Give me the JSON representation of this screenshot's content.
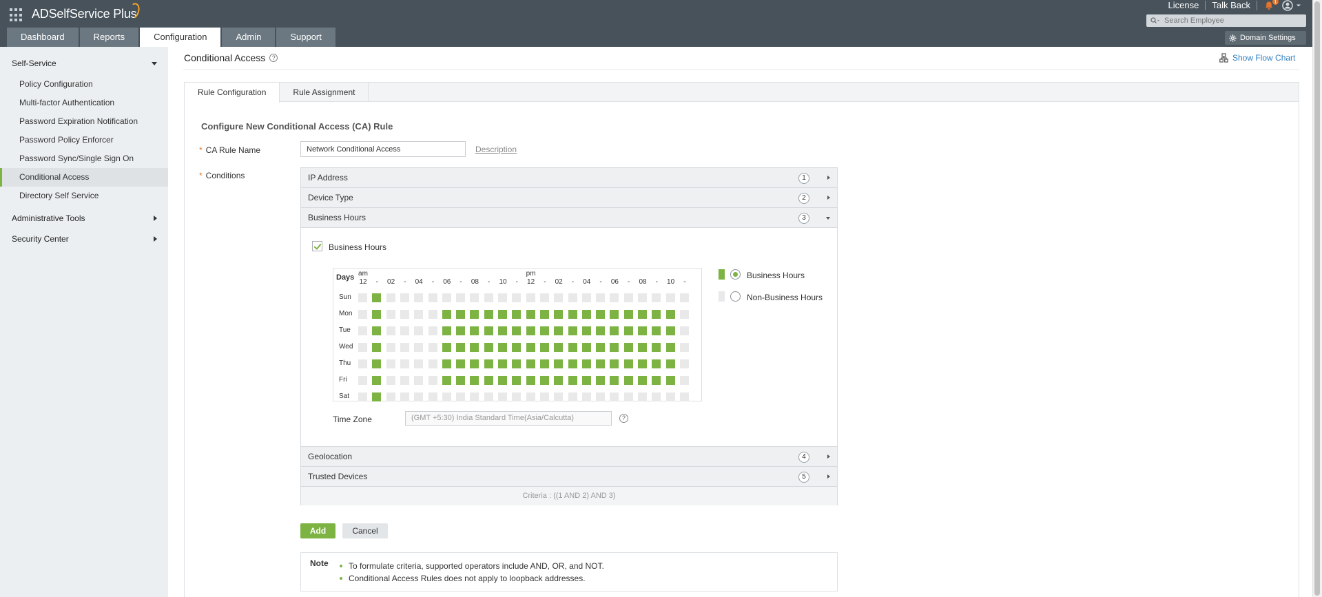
{
  "header": {
    "app_title": "ADSelfService Plus",
    "tabs": [
      {
        "label": "Dashboard",
        "active": false
      },
      {
        "label": "Reports",
        "active": false
      },
      {
        "label": "Configuration",
        "active": true
      },
      {
        "label": "Admin",
        "active": false
      },
      {
        "label": "Support",
        "active": false
      }
    ],
    "links": [
      "License",
      "Talk Back"
    ],
    "notification_count": "1",
    "search_placeholder": "Search Employee",
    "domain_settings_label": "Domain Settings"
  },
  "sidebar": {
    "sections": [
      {
        "title": "Self-Service",
        "expanded": true,
        "items": [
          {
            "label": "Policy Configuration",
            "active": false
          },
          {
            "label": "Multi-factor Authentication",
            "active": false
          },
          {
            "label": "Password Expiration Notification",
            "active": false
          },
          {
            "label": "Password Policy Enforcer",
            "active": false
          },
          {
            "label": "Password Sync/Single Sign On",
            "active": false
          },
          {
            "label": "Conditional Access",
            "active": true
          },
          {
            "label": "Directory Self Service",
            "active": false
          }
        ]
      },
      {
        "title": "Administrative Tools",
        "expanded": false,
        "items": []
      },
      {
        "title": "Security Center",
        "expanded": false,
        "items": []
      }
    ]
  },
  "page": {
    "title": "Conditional Access",
    "flow_chart_label": "Show Flow Chart",
    "tabs": [
      {
        "label": "Rule Configuration",
        "active": true
      },
      {
        "label": "Rule Assignment",
        "active": false
      }
    ],
    "section_title": "Configure New Conditional Access (CA) Rule",
    "rule_name_label": "CA Rule Name",
    "rule_name_value": "Network Conditional Access",
    "description_link": "Description",
    "conditions_label": "Conditions",
    "required_marker": "*",
    "conditions_top": [
      {
        "label": "IP Address",
        "num": "1",
        "expanded": false
      },
      {
        "label": "Device Type",
        "num": "2",
        "expanded": false
      },
      {
        "label": "Business Hours",
        "num": "3",
        "expanded": true
      }
    ],
    "conditions_bottom": [
      {
        "label": "Geolocation",
        "num": "4",
        "expanded": false
      },
      {
        "label": "Trusted Devices",
        "num": "5",
        "expanded": false
      }
    ],
    "criteria_label": "Criteria :",
    "criteria_value": "((1 AND 2) AND 3)",
    "add_label": "Add",
    "cancel_label": "Cancel",
    "note_label": "Note",
    "notes": [
      "To formulate criteria, supported operators include AND, OR, and NOT.",
      "Conditional Access Rules does not apply to loopback addresses."
    ]
  },
  "business_hours": {
    "enabled": true,
    "checkbox_label": "Business Hours",
    "days_header": "Days",
    "am_label": "am",
    "pm_label": "pm",
    "hour_labels": [
      "12",
      "-",
      "02",
      "-",
      "04",
      "-",
      "06",
      "-",
      "08",
      "-",
      "10",
      "-",
      "12",
      "-",
      "02",
      "-",
      "04",
      "-",
      "06",
      "-",
      "08",
      "-",
      "10",
      "-"
    ],
    "days": [
      "Sun",
      "Mon",
      "Tue",
      "Wed",
      "Thu",
      "Fri",
      "Sat"
    ],
    "grid": [
      [
        0,
        1,
        0,
        0,
        0,
        0,
        0,
        0,
        0,
        0,
        0,
        0,
        0,
        0,
        0,
        0,
        0,
        0,
        0,
        0,
        0,
        0,
        0,
        0
      ],
      [
        0,
        1,
        0,
        0,
        0,
        0,
        1,
        1,
        1,
        1,
        1,
        1,
        1,
        1,
        1,
        1,
        1,
        1,
        1,
        1,
        1,
        1,
        1,
        0
      ],
      [
        0,
        1,
        0,
        0,
        0,
        0,
        1,
        1,
        1,
        1,
        1,
        1,
        1,
        1,
        1,
        1,
        1,
        1,
        1,
        1,
        1,
        1,
        1,
        0
      ],
      [
        0,
        1,
        0,
        0,
        0,
        0,
        1,
        1,
        1,
        1,
        1,
        1,
        1,
        1,
        1,
        1,
        1,
        1,
        1,
        1,
        1,
        1,
        1,
        0
      ],
      [
        0,
        1,
        0,
        0,
        0,
        0,
        1,
        1,
        1,
        1,
        1,
        1,
        1,
        1,
        1,
        1,
        1,
        1,
        1,
        1,
        1,
        1,
        1,
        0
      ],
      [
        0,
        1,
        0,
        0,
        0,
        0,
        1,
        1,
        1,
        1,
        1,
        1,
        1,
        1,
        1,
        1,
        1,
        1,
        1,
        1,
        1,
        1,
        1,
        0
      ],
      [
        0,
        1,
        0,
        0,
        0,
        0,
        0,
        0,
        0,
        0,
        0,
        0,
        0,
        0,
        0,
        0,
        0,
        0,
        0,
        0,
        0,
        0,
        0,
        0
      ]
    ],
    "legend": [
      {
        "label": "Business Hours",
        "color": "#7cb342",
        "checked": true
      },
      {
        "label": "Non-Business Hours",
        "color": "#e9e9e9",
        "checked": false
      }
    ],
    "timezone_label": "Time Zone",
    "timezone_value": "(GMT +5:30) India Standard Time(Asia/Calcutta)"
  },
  "colors": {
    "header_bg": "#47525b",
    "accent_green": "#7cb342",
    "link_blue": "#2f7fc1",
    "required_orange": "#e57329"
  }
}
